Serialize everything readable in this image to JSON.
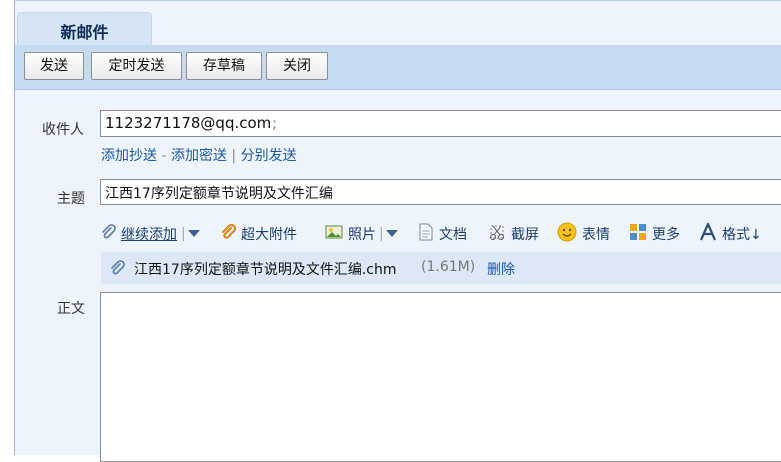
{
  "tab": {
    "title": "新邮件"
  },
  "toolbar": {
    "send": "发送",
    "scheduled_send": "定时发送",
    "save_draft": "存草稿",
    "close": "关闭"
  },
  "recipient": {
    "label": "收件人",
    "value": "1123271178@qq.com",
    "separator": ";",
    "add_cc": "添加抄送",
    "dash": "-",
    "add_bcc": "添加密送",
    "pipe": "|",
    "separate_send": "分别发送"
  },
  "subject": {
    "label": "主题",
    "value": "江西17序列定额章节说明及文件汇编"
  },
  "attach_tools": {
    "continue_add": "继续添加",
    "large_attachment": "超大附件",
    "photo": "照片",
    "document": "文档",
    "screenshot": "截屏",
    "emoji": "表情",
    "more": "更多",
    "format": "格式↓"
  },
  "attachment": {
    "file_name": "江西17序列定额章节说明及文件汇编.chm",
    "size": "(1.61M)",
    "delete": "删除"
  },
  "body": {
    "label": "正文"
  },
  "colors": {
    "toolbar_bg": "#c6daf0",
    "content_bg": "#eef4fb",
    "link": "#1a5aa8",
    "tab_text": "#0e2c55"
  }
}
